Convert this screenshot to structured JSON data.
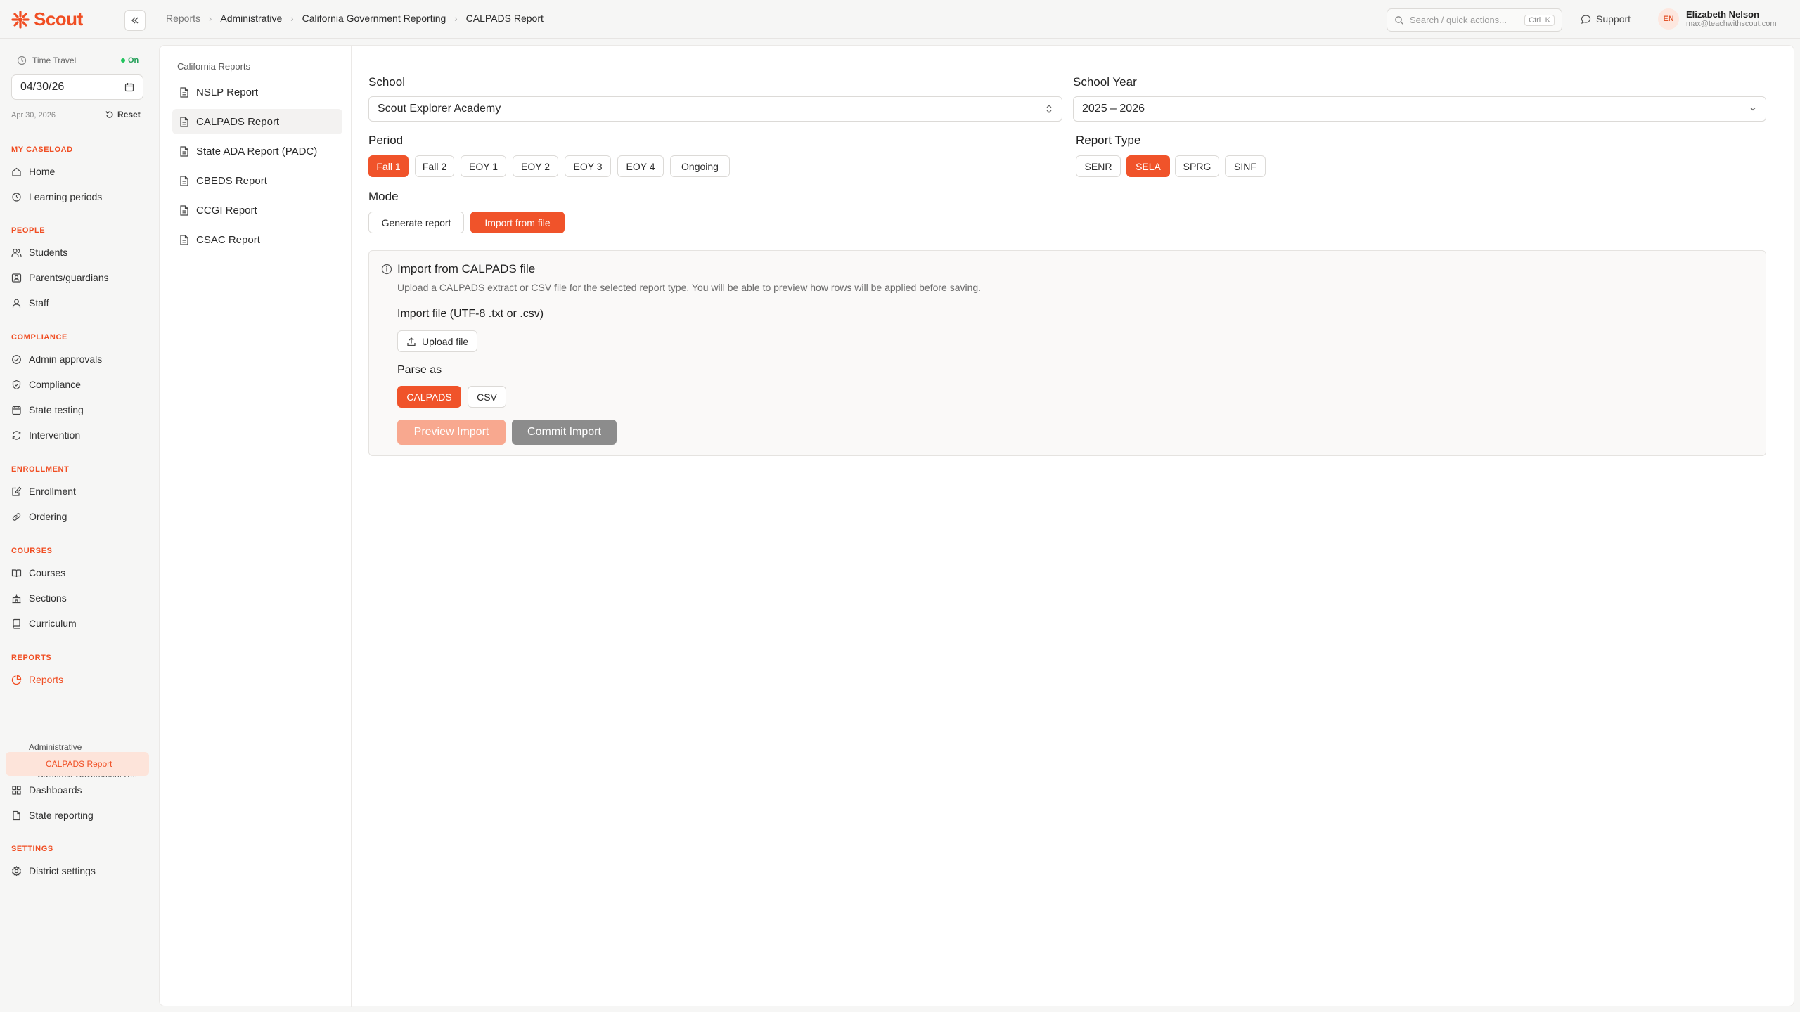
{
  "app": {
    "name": "Scout"
  },
  "breadcrumb": [
    "Reports",
    "Administrative",
    "California Government Reporting",
    "CALPADS Report"
  ],
  "search": {
    "placeholder": "Search / quick actions...",
    "shortcut": "Ctrl+K"
  },
  "support": {
    "label": "Support"
  },
  "user": {
    "initials": "EN",
    "name": "Elizabeth Nelson",
    "email": "max@teachwithscout.com"
  },
  "time_travel": {
    "label": "Time Travel",
    "status": "On",
    "date_value": "04/30/26",
    "current_date": "Apr 30, 2026",
    "reset_label": "Reset"
  },
  "sidebar": {
    "sections": {
      "caseload": "MY CASELOAD",
      "people": "PEOPLE",
      "compliance": "COMPLIANCE",
      "enrollment": "ENROLLMENT",
      "courses": "COURSES",
      "reports": "REPORTS",
      "settings": "SETTINGS"
    },
    "items": {
      "home": "Home",
      "learning_periods": "Learning periods",
      "students": "Students",
      "parents": "Parents/guardians",
      "staff": "Staff",
      "admin_approvals": "Admin approvals",
      "compliance": "Compliance",
      "state_testing": "State testing",
      "intervention": "Intervention",
      "enrollment": "Enrollment",
      "ordering": "Ordering",
      "courses": "Courses",
      "sections": "Sections",
      "curriculum": "Curriculum",
      "reports": "Reports",
      "administrative": "Administrative",
      "ca_gov_reporting": "California Government R...",
      "calpads_report": "CALPADS Report",
      "dashboards": "Dashboards",
      "state_reporting": "State reporting",
      "district_settings": "District settings"
    }
  },
  "subnav": {
    "title": "California Reports",
    "items": [
      "NSLP Report",
      "CALPADS Report",
      "State ADA Report (PADC)",
      "CBEDS Report",
      "CCGI Report",
      "CSAC Report"
    ]
  },
  "form": {
    "school_label": "School",
    "school_value": "Scout Explorer Academy",
    "year_label": "School Year",
    "year_value": "2025 – 2026",
    "period_label": "Period",
    "periods": [
      "Fall 1",
      "Fall 2",
      "EOY 1",
      "EOY 2",
      "EOY 3",
      "EOY 4",
      "Ongoing"
    ],
    "report_type_label": "Report Type",
    "report_types": [
      "SENR",
      "SELA",
      "SPRG",
      "SINF"
    ],
    "mode_label": "Mode",
    "modes": [
      "Generate report",
      "Import from file"
    ]
  },
  "import": {
    "title": "Import from CALPADS file",
    "description": "Upload a CALPADS extract or CSV file for the selected report type. You will be able to preview how rows will be applied before saving.",
    "file_label": "Import file (UTF-8 .txt or .csv)",
    "upload_label": "Upload file",
    "parse_label": "Parse as",
    "parse_options": [
      "CALPADS",
      "CSV"
    ],
    "preview_label": "Preview Import",
    "commit_label": "Commit Import"
  },
  "colors": {
    "accent": "#f0532a",
    "active_bg": "#fde4da"
  }
}
